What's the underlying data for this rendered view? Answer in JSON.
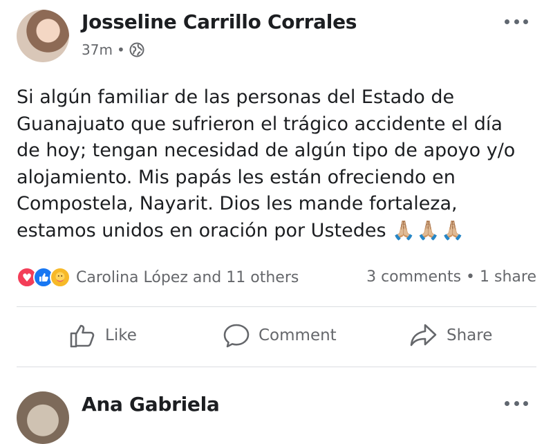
{
  "post": {
    "author": "Josseline Carrillo Corrales",
    "time": "37m",
    "separator": "•",
    "privacy_icon": "globe-icon",
    "text": "Si algún familiar de las personas del Estado de\nGuanajuato que sufrieron el trágico accidente el día\nde hoy; tengan necesidad de algún tipo de apoyo y/o\nalojamiento. Mis papás les están ofreciendo en\nCompostela, Nayarit. Dios les mande fortaleza,\nestamos unidos en oración por Ustedes",
    "emoji": "🙏🏼🙏🏼🙏🏼",
    "reactions": {
      "icons": [
        "love-icon",
        "like-icon",
        "care-icon"
      ],
      "names": "Carolina López and 11 others"
    },
    "counts": "3 comments • 1 share"
  },
  "actions": {
    "like": "Like",
    "comment": "Comment",
    "share": "Share"
  },
  "next_post": {
    "author": "Ana Gabriela"
  },
  "colors": {
    "love": "#f33e58",
    "like": "#1877f2",
    "care": "#f7b928",
    "secondary_text": "#65676b"
  }
}
